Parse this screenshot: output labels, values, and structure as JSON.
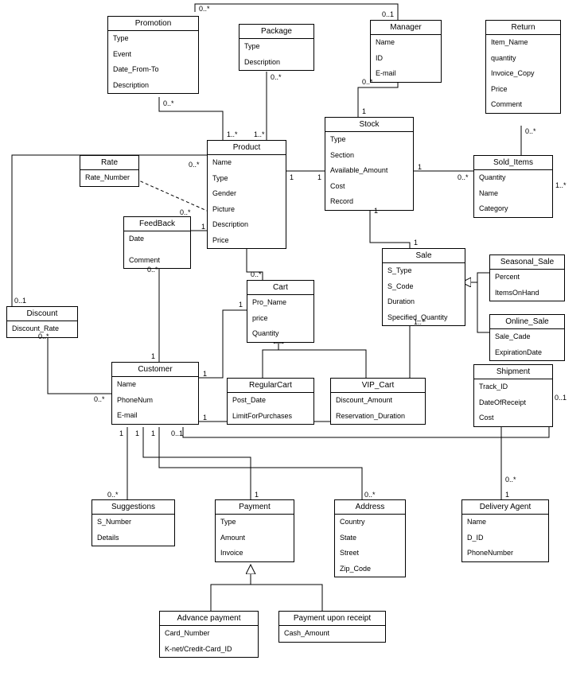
{
  "chart_data": {
    "type": "uml_class_diagram",
    "classes": [
      {
        "name": "Promotion",
        "attributes": [
          "Type",
          "Event",
          "Date_From-To",
          "Description"
        ]
      },
      {
        "name": "Package",
        "attributes": [
          "Type",
          "Description"
        ]
      },
      {
        "name": "Manager",
        "attributes": [
          "Name",
          "ID",
          "E-mail"
        ]
      },
      {
        "name": "Return",
        "attributes": [
          "Item_Name",
          "quantity",
          "Invoice_Copy",
          "Price",
          "Comment"
        ]
      },
      {
        "name": "Rate",
        "attributes": [
          "Rate_Number"
        ]
      },
      {
        "name": "Product",
        "attributes": [
          "Name",
          "Type",
          "Gender",
          "Picture",
          "Description",
          "Price"
        ]
      },
      {
        "name": "Stock",
        "attributes": [
          "Type",
          "Section",
          "Available_Amount",
          "Cost",
          "Record"
        ]
      },
      {
        "name": "Sold_Items",
        "attributes": [
          "Quantity",
          "Name",
          "Category"
        ]
      },
      {
        "name": "FeedBack",
        "attributes": [
          "Date",
          "Comment"
        ]
      },
      {
        "name": "Discount",
        "attributes": [
          "Discount_Rate"
        ]
      },
      {
        "name": "Cart",
        "attributes": [
          "Pro_Name",
          "price",
          "Quantity"
        ]
      },
      {
        "name": "Sale",
        "attributes": [
          "S_Type",
          "S_Code",
          "Duration",
          "Specified_Quantity"
        ]
      },
      {
        "name": "Seasonal_Sale",
        "attributes": [
          "Percent",
          "ItemsOnHand"
        ]
      },
      {
        "name": "Online_Sale",
        "attributes": [
          "Sale_Cade",
          "ExpirationDate"
        ]
      },
      {
        "name": "Customer",
        "attributes": [
          "Name",
          "PhoneNum",
          "E-mail"
        ]
      },
      {
        "name": "RegularCart",
        "attributes": [
          "Post_Date",
          "LimitForPurchases"
        ]
      },
      {
        "name": "VIP_Cart",
        "attributes": [
          "Discount_Amount",
          "Reservation_Duration"
        ]
      },
      {
        "name": "Shipment",
        "attributes": [
          "Track_ID",
          "DateOfReceipt",
          "Cost"
        ]
      },
      {
        "name": "Suggestions",
        "attributes": [
          "S_Number",
          "Details"
        ]
      },
      {
        "name": "Payment",
        "attributes": [
          "Type",
          "Amount",
          "Invoice"
        ]
      },
      {
        "name": "Address",
        "attributes": [
          "Country",
          "State",
          "Street",
          "Zip_Code"
        ]
      },
      {
        "name": "Delivery Agent",
        "attributes": [
          "Name",
          "D_ID",
          "PhoneNumber"
        ]
      },
      {
        "name": "Advance payment",
        "attributes": [
          "Card_Number",
          "K-net/Credit-Card_ID"
        ]
      },
      {
        "name": "Payment upon receipt",
        "attributes": [
          "Cash_Amount"
        ]
      }
    ],
    "associations": [
      {
        "from": "Promotion",
        "to": "Manager",
        "from_mult": "0..*",
        "to_mult": "0..1"
      },
      {
        "from": "Promotion",
        "to": "Product",
        "from_mult": "0..*",
        "to_mult": "1..*"
      },
      {
        "from": "Package",
        "to": "Product",
        "from_mult": "0..*",
        "to_mult": "1..*"
      },
      {
        "from": "Manager",
        "to": "Stock",
        "from_mult": "0..*",
        "to_mult": "1"
      },
      {
        "from": "Return",
        "to": "Sold_Items",
        "from_mult": "0..*",
        "to_mult": "1..*"
      },
      {
        "from": "Rate",
        "to": "Product",
        "from_mult": "0..*",
        "to_mult": "1",
        "style": "dependency"
      },
      {
        "from": "Product",
        "to": "Stock",
        "from_mult": "1",
        "to_mult": "1"
      },
      {
        "from": "Stock",
        "to": "Sold_Items",
        "from_mult": "1",
        "to_mult": "0..*"
      },
      {
        "from": "Stock",
        "to": "Sale",
        "from_mult": "1",
        "to_mult": "1"
      },
      {
        "from": "FeedBack",
        "to": "Product",
        "from_mult": "0..*",
        "to_mult": "1"
      },
      {
        "from": "FeedBack",
        "to": "Customer",
        "from_mult": "0..*",
        "to_mult": "1"
      },
      {
        "from": "Discount",
        "to": "Product",
        "from_mult": "0..1",
        "to_mult": "0..*"
      },
      {
        "from": "Discount",
        "to": "Customer",
        "from_mult": "0..*",
        "to_mult": "0..*"
      },
      {
        "from": "Product",
        "to": "Cart",
        "from_mult": "0..*",
        "to_mult": "1"
      },
      {
        "from": "Customer",
        "to": "Cart",
        "from_mult": "1",
        "to_mult": "1"
      },
      {
        "from": "Customer",
        "to": "Sale",
        "from_mult": "1",
        "to_mult": "1..*"
      },
      {
        "from": "Customer",
        "to": "Shipment",
        "from_mult": "0..1",
        "to_mult": "0..1"
      },
      {
        "from": "Customer",
        "to": "Suggestions",
        "from_mult": "1",
        "to_mult": "0..*"
      },
      {
        "from": "Customer",
        "to": "Payment",
        "from_mult": "1",
        "to_mult": "1"
      },
      {
        "from": "Customer",
        "to": "Address",
        "from_mult": "1",
        "to_mult": "0..*"
      },
      {
        "from": "Shipment",
        "to": "Delivery Agent",
        "from_mult": "0..*",
        "to_mult": "1"
      }
    ],
    "generalizations": [
      {
        "parent": "Cart",
        "children": [
          "RegularCart",
          "VIP_Cart"
        ]
      },
      {
        "parent": "Payment",
        "children": [
          "Advance payment",
          "Payment upon receipt"
        ]
      },
      {
        "parent": "Sale",
        "children": [
          "Seasonal_Sale",
          "Online_Sale"
        ]
      }
    ]
  },
  "classes": {
    "promotion": {
      "title": "Promotion",
      "a0": "Type",
      "a1": "Event",
      "a2": "Date_From-To",
      "a3": "Description"
    },
    "package": {
      "title": "Package",
      "a0": "Type",
      "a1": "Description"
    },
    "manager": {
      "title": "Manager",
      "a0": "Name",
      "a1": "ID",
      "a2": "E-mail"
    },
    "return": {
      "title": "Return",
      "a0": "Item_Name",
      "a1": "quantity",
      "a2": "Invoice_Copy",
      "a3": "Price",
      "a4": "Comment"
    },
    "rate": {
      "title": "Rate",
      "a0": "Rate_Number"
    },
    "product": {
      "title": "Product",
      "a0": "Name",
      "a1": "Type",
      "a2": "Gender",
      "a3": "Picture",
      "a4": "Description",
      "a5": "Price"
    },
    "stock": {
      "title": "Stock",
      "a0": "Type",
      "a1": "Section",
      "a2": "Available_Amount",
      "a3": "Cost",
      "a4": "Record"
    },
    "sold_items": {
      "title": "Sold_Items",
      "a0": "Quantity",
      "a1": "Name",
      "a2": "Category"
    },
    "feedback": {
      "title": "FeedBack",
      "a0": "Date",
      "a1": "Comment"
    },
    "discount": {
      "title": "Discount",
      "a0": "Discount_Rate"
    },
    "cart": {
      "title": "Cart",
      "a0": "Pro_Name",
      "a1": "price",
      "a2": "Quantity"
    },
    "sale": {
      "title": "Sale",
      "a0": "S_Type",
      "a1": "S_Code",
      "a2": "Duration",
      "a3": "Specified_Quantity"
    },
    "seasonal_sale": {
      "title": "Seasonal_Sale",
      "a0": "Percent",
      "a1": "ItemsOnHand"
    },
    "online_sale": {
      "title": "Online_Sale",
      "a0": "Sale_Cade",
      "a1": "ExpirationDate"
    },
    "customer": {
      "title": "Customer",
      "a0": "Name",
      "a1": "PhoneNum",
      "a2": "E-mail"
    },
    "regularcart": {
      "title": "RegularCart",
      "a0": "Post_Date",
      "a1": "LimitForPurchases"
    },
    "vip_cart": {
      "title": "VIP_Cart",
      "a0": "Discount_Amount",
      "a1": "Reservation_Duration"
    },
    "shipment": {
      "title": "Shipment",
      "a0": "Track_ID",
      "a1": "DateOfReceipt",
      "a2": "Cost"
    },
    "suggestions": {
      "title": "Suggestions",
      "a0": "S_Number",
      "a1": "Details"
    },
    "payment": {
      "title": "Payment",
      "a0": "Type",
      "a1": "Amount",
      "a2": "Invoice"
    },
    "address": {
      "title": "Address",
      "a0": "Country",
      "a1": "State",
      "a2": "Street",
      "a3": "Zip_Code"
    },
    "delivery_agent": {
      "title": "Delivery Agent",
      "a0": "Name",
      "a1": "D_ID",
      "a2": "PhoneNumber"
    },
    "advance_payment": {
      "title": "Advance payment",
      "a0": "Card_Number",
      "a1": "K-net/Credit-Card_ID"
    },
    "payment_upon_receipt": {
      "title": "Payment upon receipt",
      "a0": "Cash_Amount"
    }
  },
  "mult": {
    "m1": "0..*",
    "m2": "0..1",
    "m3": "0..*",
    "m4": "1..*",
    "m5": "0..*",
    "m6": "1..*",
    "m7": "0..*",
    "m8": "1",
    "m9": "0..*",
    "m10": "1..*",
    "m11": "0..*",
    "m12": "1",
    "m13": "1",
    "m14": "1",
    "m15": "1",
    "m16": "0..*",
    "m17": "1",
    "m18": "1",
    "m19": "0..*",
    "m20": "1",
    "m21": "0..*",
    "m22": "1",
    "m23": "0..1",
    "m24": "0..*",
    "m25": "0..*",
    "m26": "0..*",
    "m27": "0..*",
    "m28": "1",
    "m29": "1",
    "m30": "1",
    "m31": "1",
    "m32": "1..*",
    "m33": "0..1",
    "m34": "0..1",
    "m35": "1",
    "m36": "0..*",
    "m37": "1",
    "m38": "1",
    "m39": "1",
    "m40": "0..*",
    "m41": "0..*",
    "m42": "1"
  }
}
